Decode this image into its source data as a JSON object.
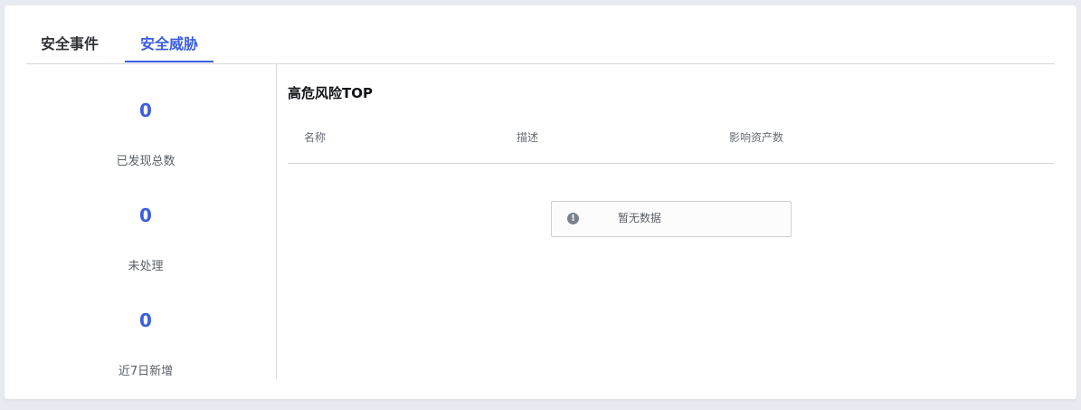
{
  "tabs": [
    {
      "label": "安全事件",
      "active": false
    },
    {
      "label": "安全威胁",
      "active": true
    }
  ],
  "stats": [
    {
      "value": "0",
      "label": "已发现总数"
    },
    {
      "value": "0",
      "label": "未处理"
    },
    {
      "value": "0",
      "label": "近7日新增"
    }
  ],
  "top_risks": {
    "title": "高危风险TOP",
    "columns": [
      "名称",
      "描述",
      "影响资产数"
    ],
    "rows": [],
    "empty_text": "暂无数据",
    "empty_icon": "info-circle-icon"
  },
  "colors": {
    "accent": "#3b5ee0",
    "text": "#303236",
    "muted": "#5b6068",
    "divider": "#d6d8de"
  }
}
